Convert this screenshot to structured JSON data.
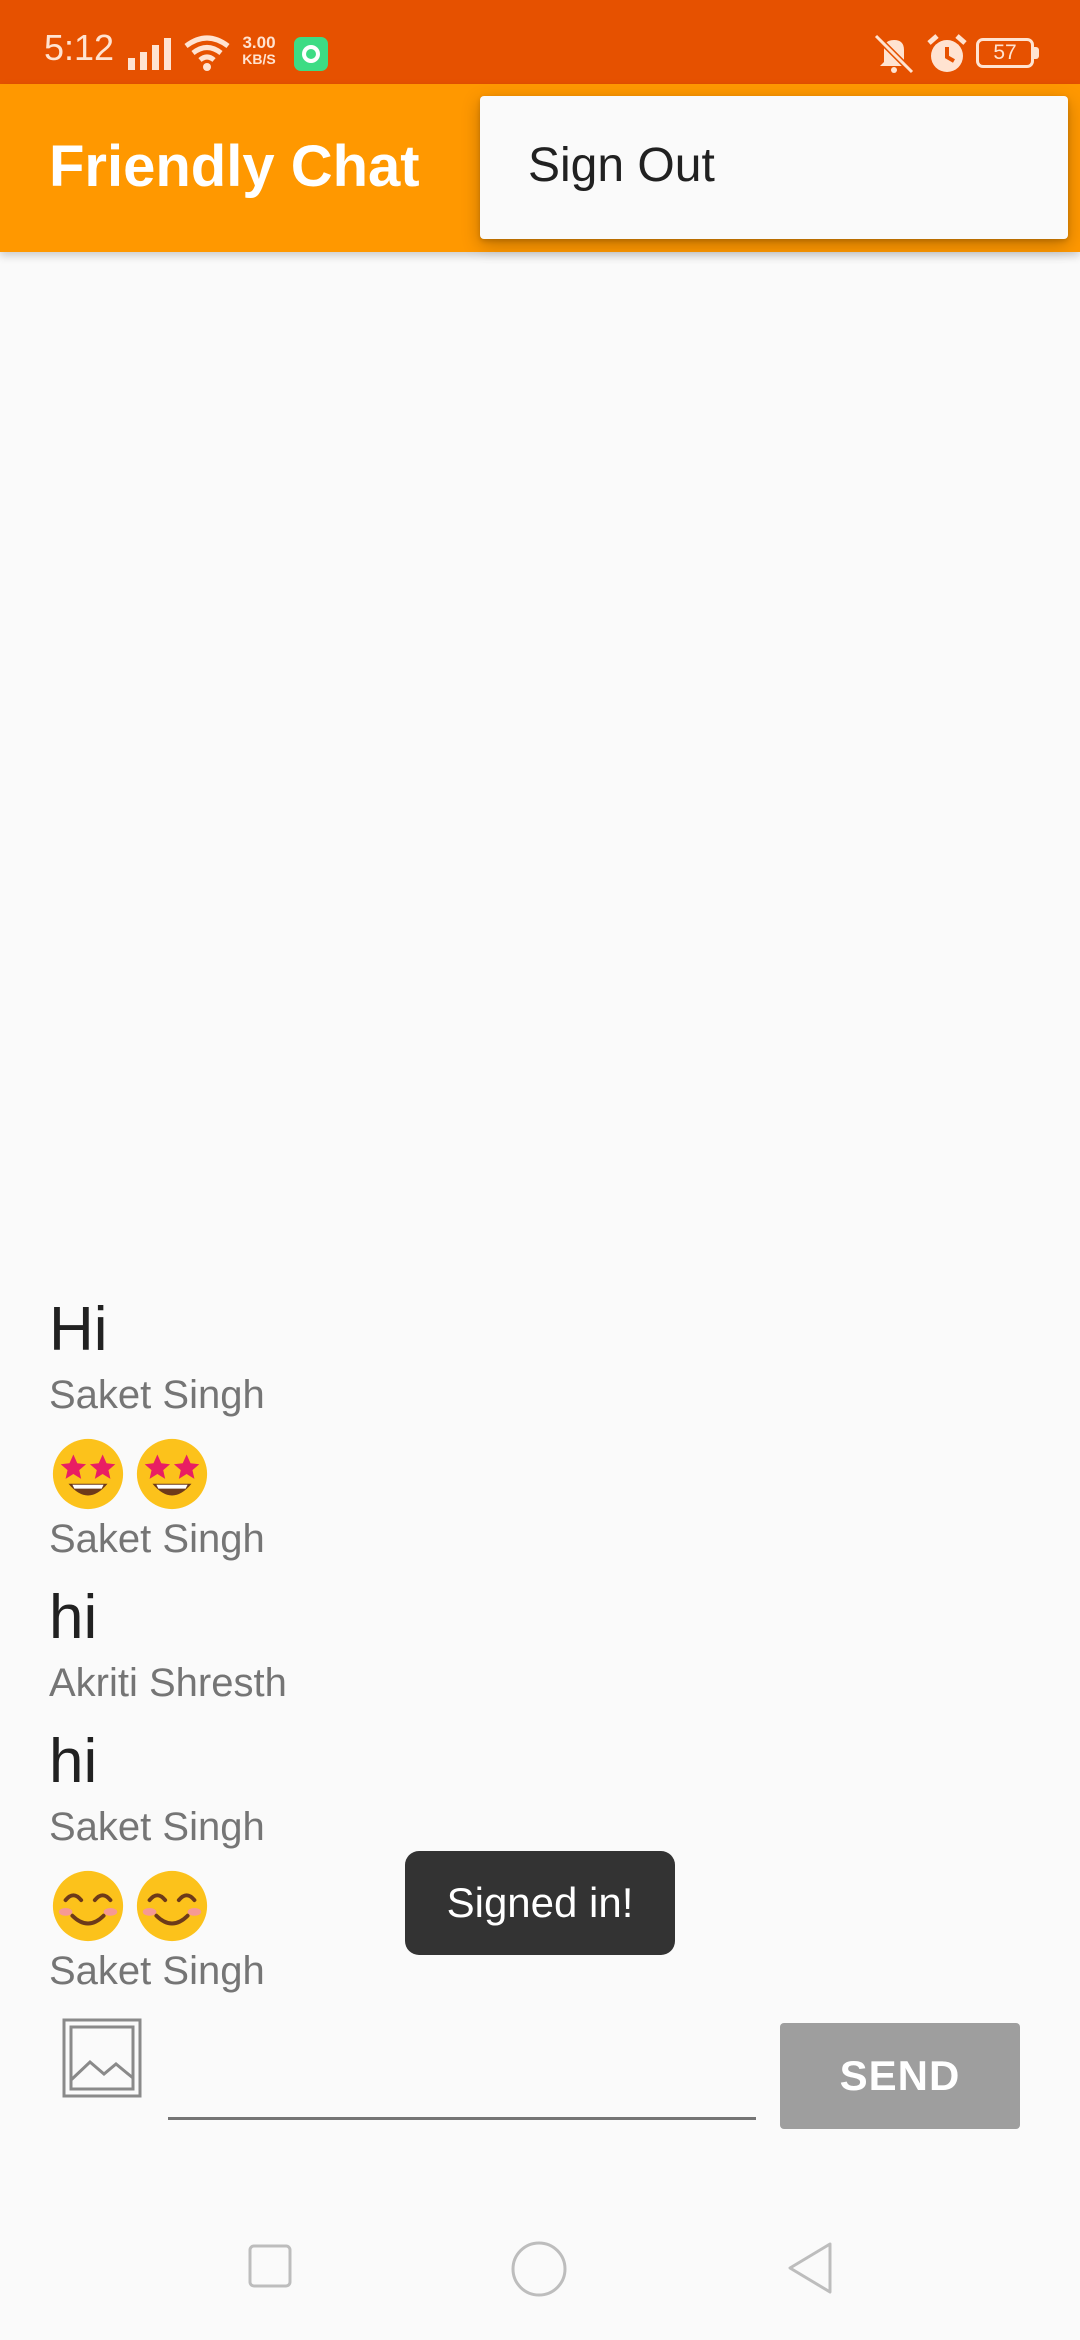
{
  "status_bar": {
    "time": "5:12",
    "net_speed_value": "3.00",
    "net_speed_unit": "KB/S",
    "battery": "57",
    "icons": [
      "signal-icon",
      "wifi-icon",
      "app-notification-icon",
      "mute-icon",
      "alarm-icon",
      "battery-icon"
    ]
  },
  "app_bar": {
    "title": "Friendly Chat",
    "background": "#ff9800"
  },
  "menu": {
    "items": [
      {
        "label": "Sign Out"
      }
    ]
  },
  "messages": [
    {
      "text": "Hi",
      "author": "Saket Singh"
    },
    {
      "emoji": [
        "star-struck-emoji",
        "star-struck-emoji"
      ],
      "author": "Saket Singh"
    },
    {
      "text": "hi",
      "author": "Akriti Shresth"
    },
    {
      "text": "hi",
      "author": "Saket Singh"
    },
    {
      "emoji": [
        "smiling-face-emoji",
        "smiling-face-emoji"
      ],
      "author": "Saket Singh"
    }
  ],
  "toast": {
    "text": "Signed in!"
  },
  "composer": {
    "input_value": "",
    "send_label": "SEND"
  },
  "nav_bar": {
    "buttons": [
      "recents-icon",
      "home-icon",
      "back-icon"
    ]
  },
  "colors": {
    "status_bar": "#e65100",
    "accent": "#ff9800",
    "send_disabled": "#9e9e9e",
    "toast": "#333333"
  }
}
